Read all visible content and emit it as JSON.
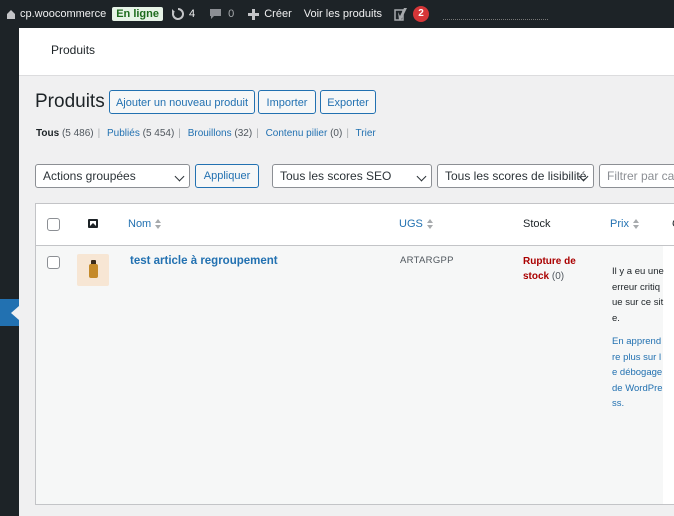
{
  "admin_bar": {
    "site_name": "cp.woocommerce",
    "status_badge": "En ligne",
    "updates_count": "4",
    "comments_count": "0",
    "create_label": "Créer",
    "view_products_label": "Voir les produits",
    "yoast_count": "2"
  },
  "header": {
    "title": "Produits"
  },
  "page": {
    "heading": "Produits",
    "add_new": "Ajouter un nouveau produit",
    "import": "Importer",
    "export": "Exporter"
  },
  "views": [
    {
      "label": "Tous",
      "count": "(5 486)"
    },
    {
      "label": "Publiés",
      "count": "(5 454)"
    },
    {
      "label": "Brouillons",
      "count": "(32)"
    },
    {
      "label": "Contenu pilier",
      "count": "(0)"
    },
    {
      "label": "Trier",
      "count": ""
    }
  ],
  "filters": {
    "bulk_actions": "Actions groupées",
    "apply": "Appliquer",
    "seo_scores": "Tous les scores SEO",
    "readability_scores": "Tous les scores de lisibilité",
    "category_placeholder": "Filtrer par catégorie"
  },
  "table": {
    "columns": {
      "name": "Nom",
      "sku": "UGS",
      "stock": "Stock",
      "price": "Prix",
      "next": "C"
    },
    "rows": [
      {
        "name": "test article à regroupement",
        "sku": "ARTARGPP",
        "stock_status": "Rupture de stock",
        "stock_count": "(0)",
        "price_error": "Il y a eu une erreur critique sur ce site.",
        "price_link": "En apprendre plus sur le débogage de WordPress."
      }
    ]
  },
  "colors": {
    "admin_bar": "#1d2327",
    "accent": "#2271b1",
    "out_of_stock": "#aa0000",
    "badge_red": "#d63638"
  }
}
